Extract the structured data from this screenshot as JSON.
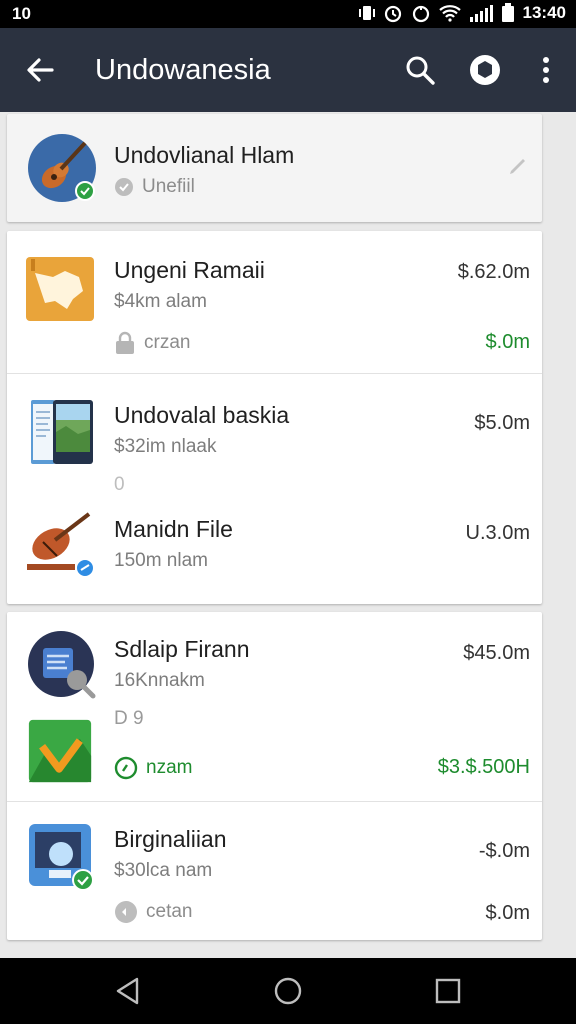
{
  "status_bar": {
    "left_text": "10",
    "time": "13:40"
  },
  "app_bar": {
    "title": "Undowanesia"
  },
  "header_card": {
    "name": "Undovlianal Hlam",
    "subtitle": "Unefiil"
  },
  "items": [
    {
      "name": "Ungeni Ramaii",
      "subtitle": "$4km alam",
      "meta": "crzan",
      "price": "$.62.0m",
      "price2": "$.0m"
    },
    {
      "name": "Undovalal baskia",
      "subtitle": "$32im nlaak",
      "meta": "0",
      "price": "$5.0m"
    },
    {
      "name": "Manidn File",
      "subtitle": "150m nlam",
      "price": "U.3.0m"
    },
    {
      "name": "Sdlaip Firann",
      "subtitle": "16Knnakm",
      "meta": "D 9",
      "price": "$45.0m"
    },
    {
      "name": "",
      "meta": "nzam",
      "price": "$3.$.500H"
    },
    {
      "name": "Birginaliian",
      "subtitle": "$30lca nam",
      "meta": "cetan",
      "price": "-$.0m",
      "price2": "$.0m"
    }
  ]
}
